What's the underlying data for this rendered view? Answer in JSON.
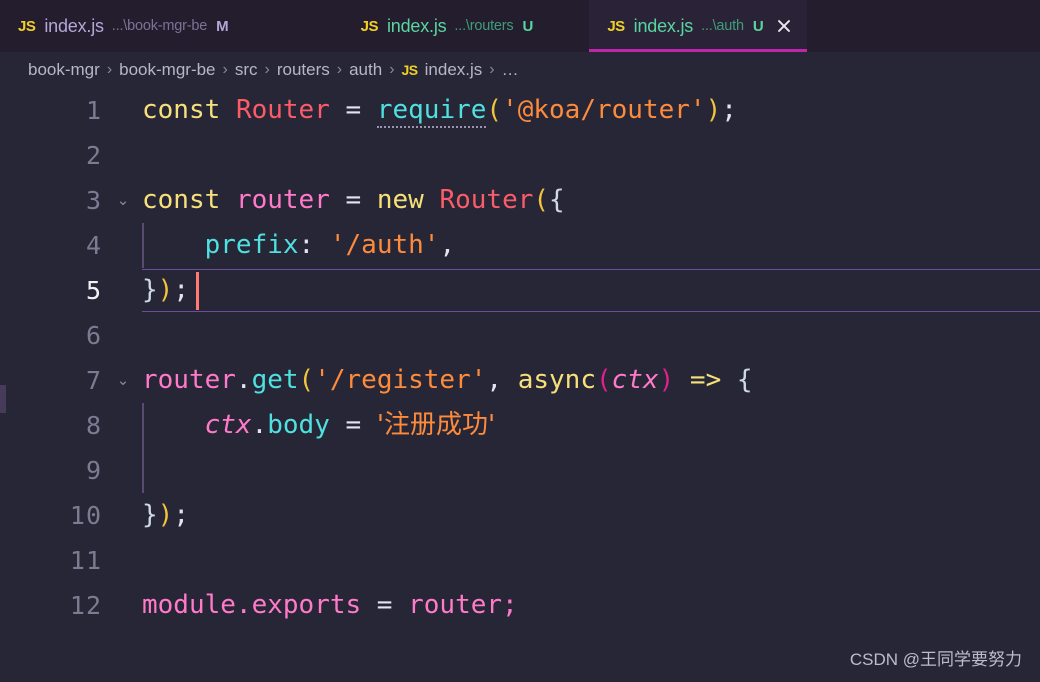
{
  "window": {
    "background": "#262636",
    "tabbar_background": "#241d2e",
    "active_tab_background": "#2a2338",
    "active_tab_underline": "#c026a8"
  },
  "tabs": [
    {
      "icon": "js-file-icon",
      "icon_label": "JS",
      "name": "index.js",
      "description": "...\\book-mgr-be",
      "badge": "M",
      "state": "modified",
      "active": false,
      "closable": false
    },
    {
      "icon": "js-file-icon",
      "icon_label": "JS",
      "name": "index.js",
      "description": "...\\routers",
      "badge": "U",
      "state": "untracked",
      "active": false,
      "closable": false
    },
    {
      "icon": "js-file-icon",
      "icon_label": "JS",
      "name": "index.js",
      "description": "...\\auth",
      "badge": "U",
      "state": "untracked",
      "active": true,
      "closable": true
    }
  ],
  "breadcrumb": {
    "separator": "›",
    "items": [
      {
        "label": "book-mgr",
        "icon": ""
      },
      {
        "label": "book-mgr-be",
        "icon": ""
      },
      {
        "label": "src",
        "icon": ""
      },
      {
        "label": "routers",
        "icon": ""
      },
      {
        "label": "auth",
        "icon": ""
      },
      {
        "label": "index.js",
        "icon": "js-file-icon",
        "icon_label": "JS"
      },
      {
        "label": "…",
        "icon": ""
      }
    ]
  },
  "editor": {
    "active_line": 5,
    "cursor": {
      "line": 5,
      "column": 4
    },
    "lines": [
      {
        "n": "1",
        "fold": "",
        "text": "const Router = require('@koa/router');"
      },
      {
        "n": "2",
        "fold": "",
        "text": ""
      },
      {
        "n": "3",
        "fold": "⌄",
        "text": "const router = new Router({"
      },
      {
        "n": "4",
        "fold": "",
        "text": "    prefix: '/auth',"
      },
      {
        "n": "5",
        "fold": "",
        "text": "});"
      },
      {
        "n": "6",
        "fold": "",
        "text": ""
      },
      {
        "n": "7",
        "fold": "⌄",
        "text": "router.get('/register', async(ctx) => {"
      },
      {
        "n": "8",
        "fold": "",
        "text": "    ctx.body = '注册成功'"
      },
      {
        "n": "9",
        "fold": "",
        "text": ""
      },
      {
        "n": "10",
        "fold": "",
        "text": "});"
      },
      {
        "n": "11",
        "fold": "",
        "text": ""
      },
      {
        "n": "12",
        "fold": "",
        "text": "module.exports = router;"
      }
    ],
    "tokens": {
      "l1": {
        "const": "const",
        "sp1": " ",
        "Router": "Router",
        "eq": " = ",
        "require": "require",
        "lp": "(",
        "str": "'@koa/router'",
        "rp": ")",
        "semi": ";"
      },
      "l3": {
        "const": "const",
        "sp1": " ",
        "router": "router",
        "eq": " = ",
        "new": "new",
        "sp2": " ",
        "Router": "Router",
        "lp": "(",
        "brace": "{"
      },
      "l4": {
        "indent": "    ",
        "prefix": "prefix",
        "colon": ": ",
        "str": "'/auth'",
        "comma": ","
      },
      "l5": {
        "brace": "}",
        "rp": ")",
        "semi": ";"
      },
      "l7": {
        "router": "router",
        "dot": ".",
        "get": "get",
        "lp": "(",
        "str": "'/register'",
        "comma": ", ",
        "async": "async",
        "lpm": "(",
        "ctx": "ctx",
        "rpm": ")",
        "arrow": " => ",
        "brace": "{"
      },
      "l8": {
        "indent": "    ",
        "ctx": "ctx",
        "dot": ".",
        "body": "body",
        "eq": " = ",
        "str": "'注册成功'"
      },
      "l10": {
        "brace": "}",
        "rp": ")",
        "semi": ";"
      },
      "l12": {
        "module": "module",
        "dot": ".",
        "exports": "exports",
        "eq": " = ",
        "router": "router",
        "semi": ";"
      }
    },
    "colors": {
      "keyword": "#f7e07a",
      "class": "#fc5b69",
      "function": "#4fe0e0",
      "variable": "#ff7ac8",
      "string": "#fd8b3c",
      "paren_gold": "#f2c33c",
      "paren_magenta": "#e0218a",
      "operator": "#e6e3f0",
      "line_number": "#7e7a92",
      "active_line_number": "#f2f0f7",
      "cursor": "#ff7b72",
      "indent_guide": "#574b72",
      "active_line_border": "#6b4e9c"
    }
  },
  "watermark": {
    "text": "CSDN @王同学要努力"
  }
}
